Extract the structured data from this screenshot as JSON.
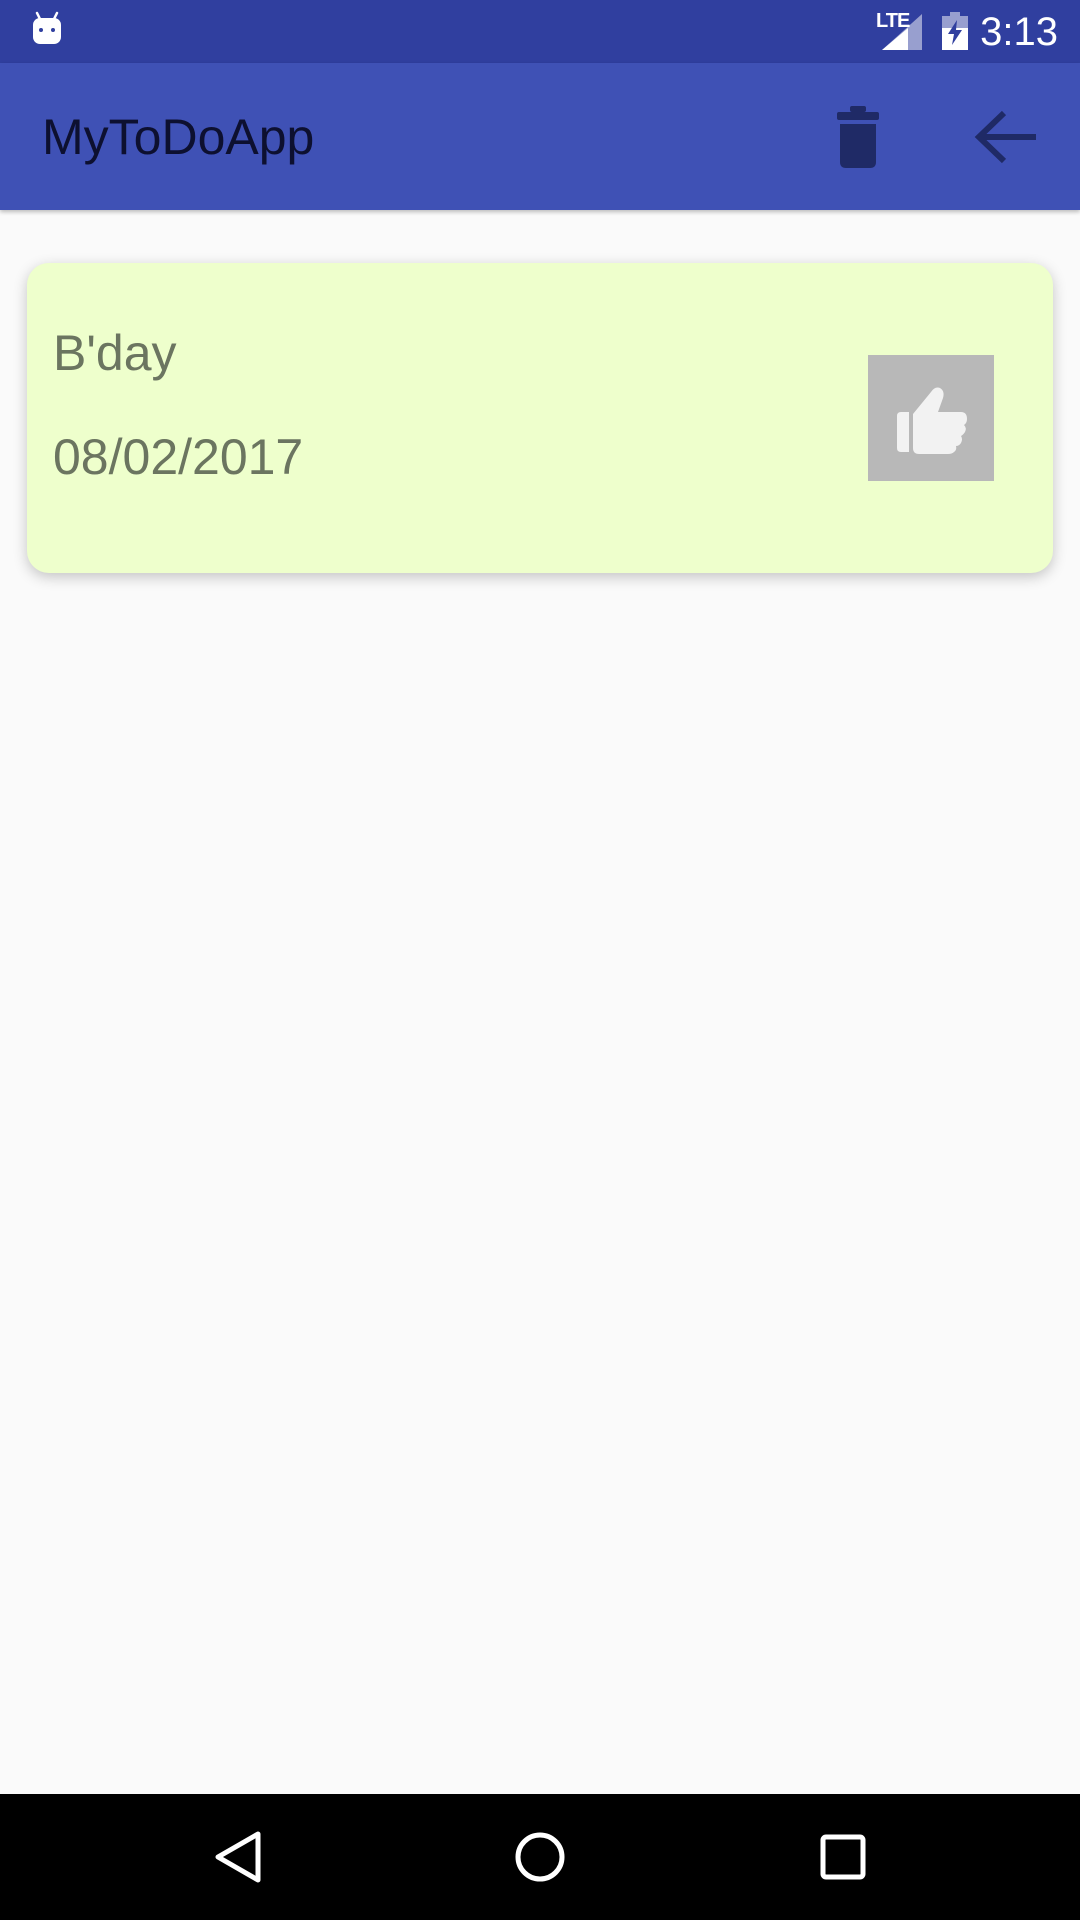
{
  "status_bar": {
    "network_label": "LTE",
    "time": "3:13",
    "icons": [
      "android-notification-icon",
      "signal-icon",
      "battery-charging-icon"
    ]
  },
  "app_bar": {
    "title": "MyToDoApp",
    "actions": [
      "trash-icon",
      "arrow-back-icon"
    ]
  },
  "todo_list": {
    "items": [
      {
        "title": "B'day",
        "date": "08/02/2017",
        "action_icon": "thumbs-up-icon"
      }
    ]
  },
  "nav_bar": {
    "buttons": [
      "nav-back-icon",
      "nav-home-icon",
      "nav-recents-icon"
    ]
  },
  "colors": {
    "status_bar": "#303F9F",
    "app_bar": "#3F51B5",
    "card_background": "#EEFFCC",
    "card_text": "#6B7560",
    "thumb_button": "#B8B8B8",
    "background": "#FAFAFA"
  }
}
